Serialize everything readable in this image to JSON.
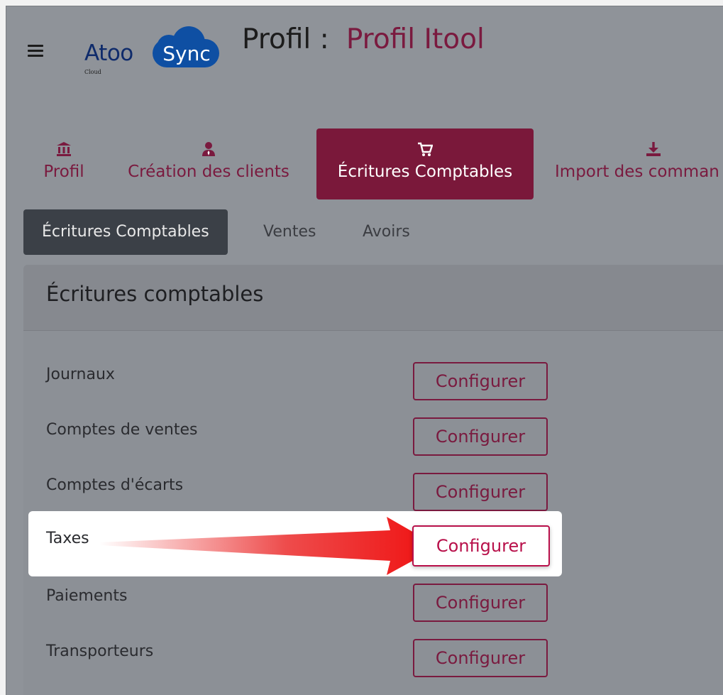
{
  "header": {
    "logo_text_left": "Atoo",
    "logo_text_cloud": "Sync",
    "logo_subtext": "Cloud",
    "title_prefix": "Profil :",
    "profile_name": "Profil Itool"
  },
  "tabs": [
    {
      "label": "Profil",
      "icon": "bank-icon"
    },
    {
      "label": "Création des clients",
      "icon": "user-tie-icon"
    },
    {
      "label": "Écritures Comptables",
      "icon": "cart-icon",
      "active": true
    },
    {
      "label": "Import des comman",
      "icon": "download-icon"
    }
  ],
  "subtabs": [
    {
      "label": "Écritures Comptables",
      "active": true
    },
    {
      "label": "Ventes"
    },
    {
      "label": "Avoirs"
    }
  ],
  "card": {
    "title": "Écritures comptables",
    "rows": [
      {
        "label": "Journaux",
        "button": "Configurer"
      },
      {
        "label": "Comptes de ventes",
        "button": "Configurer"
      },
      {
        "label": "Comptes d'écarts",
        "button": "Configurer"
      },
      {
        "label": "Taxes",
        "button": "Configurer",
        "highlighted": true
      },
      {
        "label": "Paiements",
        "button": "Configurer"
      },
      {
        "label": "Transporteurs",
        "button": "Configurer"
      }
    ]
  },
  "colors": {
    "accent": "#7a1a3f",
    "highlight_button": "#b8104a",
    "arrow": "#e81010",
    "overlay": "#8f9399"
  }
}
